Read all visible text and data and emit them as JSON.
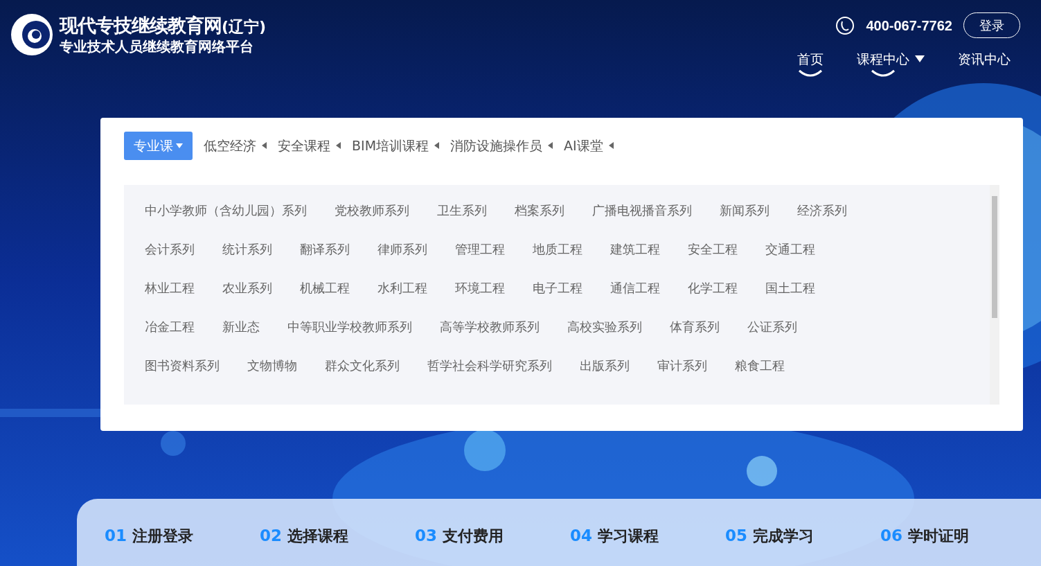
{
  "header": {
    "logo_title": "现代专技继续教育网",
    "logo_region": "(辽宁)",
    "logo_subtitle": "专业技术人员继续教育网络平台",
    "phone": "400-067-7762",
    "login": "登录"
  },
  "nav": [
    {
      "label": "首页",
      "selected": true,
      "has_menu": false
    },
    {
      "label": "课程中心",
      "selected": true,
      "has_menu": true
    },
    {
      "label": "资讯中心",
      "selected": false,
      "has_menu": false
    }
  ],
  "dropdown": {
    "tabs": [
      {
        "label": "专业课",
        "selected": true
      },
      {
        "label": "低空经济",
        "selected": false
      },
      {
        "label": "安全课程",
        "selected": false
      },
      {
        "label": "BIM培训课程",
        "selected": false
      },
      {
        "label": "消防设施操作员",
        "selected": false
      },
      {
        "label": "AI课堂",
        "selected": false
      }
    ],
    "rows": [
      [
        "中小学教师（含幼儿园）系列",
        "党校教师系列",
        "卫生系列",
        "档案系列",
        "广播电视播音系列",
        "新闻系列",
        "经济系列"
      ],
      [
        "会计系列",
        "统计系列",
        "翻译系列",
        "律师系列",
        "管理工程",
        "地质工程",
        "建筑工程",
        "安全工程",
        "交通工程"
      ],
      [
        "林业工程",
        "农业系列",
        "机械工程",
        "水利工程",
        "环境工程",
        "电子工程",
        "通信工程",
        "化学工程",
        "国土工程"
      ],
      [
        "冶金工程",
        "新业态",
        "中等职业学校教师系列",
        "高等学校教师系列",
        "高校实验系列",
        "体育系列",
        "公证系列"
      ],
      [
        "图书资料系列",
        "文物博物",
        "群众文化系列",
        "哲学社会科学研究系列",
        "出版系列",
        "审计系列",
        "粮食工程"
      ]
    ]
  },
  "steps": [
    {
      "number": "01",
      "label": "注册登录"
    },
    {
      "number": "02",
      "label": "选择课程"
    },
    {
      "number": "03",
      "label": "支付费用"
    },
    {
      "number": "04",
      "label": "学习课程"
    },
    {
      "number": "05",
      "label": "完成学习"
    },
    {
      "number": "06",
      "label": "学时证明"
    }
  ]
}
